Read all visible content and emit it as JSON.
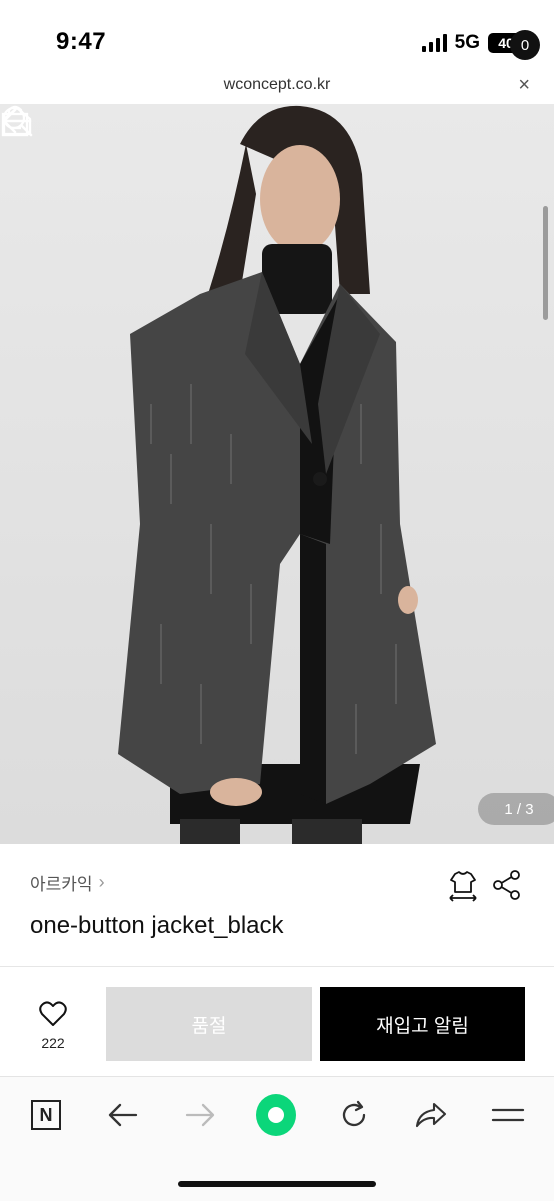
{
  "status": {
    "time": "9:47",
    "network": "5G",
    "battery": "40"
  },
  "browser": {
    "url": "wconcept.co.kr",
    "close": "×"
  },
  "hero": {
    "cart_count": "0",
    "page_indicator": "1 / 3"
  },
  "product": {
    "brand": "아르카익",
    "brand_chevron": "›",
    "name": "one-button jacket_black",
    "likes": "222"
  },
  "actions": {
    "soldout_label": "품절",
    "restock_label": "재입고 알림"
  },
  "toolbar": {
    "naver_logo": "N"
  },
  "colors": {
    "accent_green": "#0bd67a",
    "primary_black": "#000000",
    "disabled_gray": "#dcdcdc"
  }
}
